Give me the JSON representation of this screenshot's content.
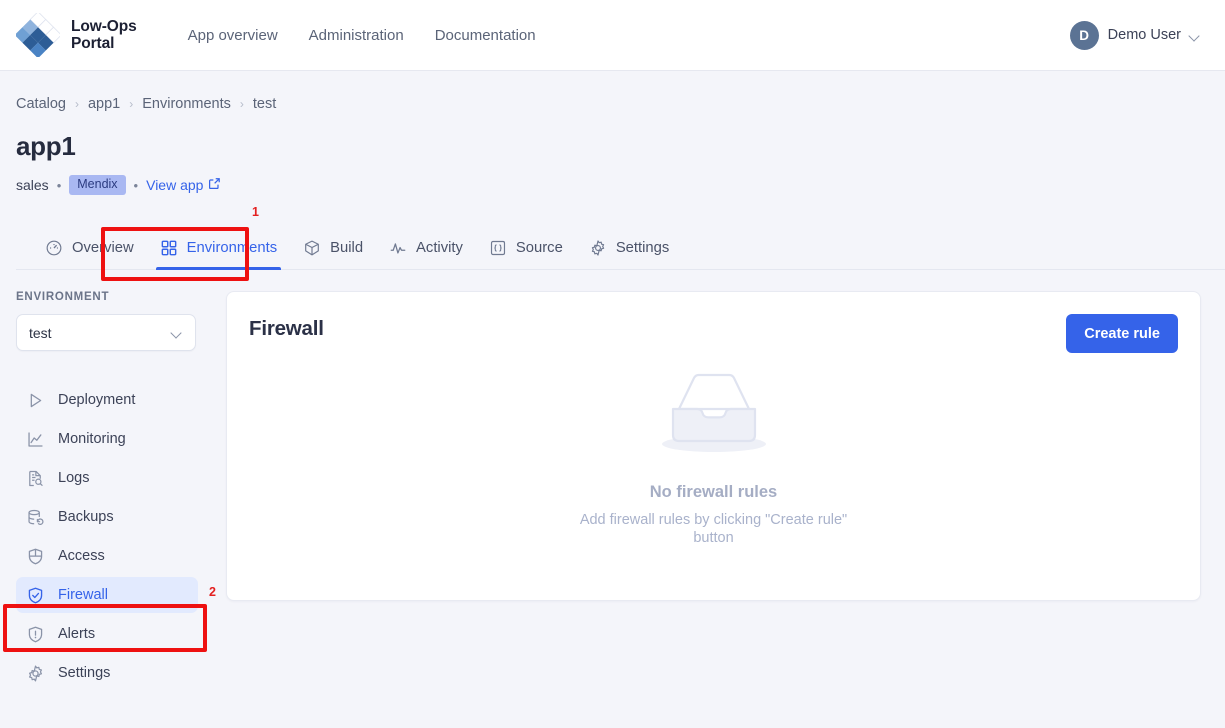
{
  "app": {
    "brand_line1": "Low-Ops",
    "brand_line2": "Portal",
    "logo_icon": "diamond-grid-logo"
  },
  "topnav": {
    "links": [
      {
        "label": "App overview"
      },
      {
        "label": "Administration"
      },
      {
        "label": "Documentation"
      }
    ],
    "user": {
      "initial": "D",
      "name": "Demo User",
      "caret_icon": "chevron-down-icon"
    }
  },
  "breadcrumb": {
    "separator": "›",
    "items": [
      {
        "label": "Catalog"
      },
      {
        "label": "app1"
      },
      {
        "label": "Environments"
      },
      {
        "label": "test"
      }
    ]
  },
  "header": {
    "title": "app1",
    "owner": "sales",
    "dot": "•",
    "badge": "Mendix",
    "view_app": "View app",
    "view_app_icon": "external-link-icon"
  },
  "tabs": [
    {
      "label": "Overview",
      "icon": "gauge-icon",
      "active": false
    },
    {
      "label": "Environments",
      "icon": "grid-icon",
      "active": true
    },
    {
      "label": "Build",
      "icon": "box-icon",
      "active": false
    },
    {
      "label": "Activity",
      "icon": "pulse-icon",
      "active": false
    },
    {
      "label": "Source",
      "icon": "code-braces-icon",
      "active": false
    },
    {
      "label": "Settings",
      "icon": "gear-icon",
      "active": false
    }
  ],
  "sidebar": {
    "section_label": "ENVIRONMENT",
    "env_select": {
      "value": "test",
      "caret_icon": "chevron-down-icon"
    },
    "items": [
      {
        "label": "Deployment",
        "icon": "play-triangle-icon",
        "active": false
      },
      {
        "label": "Monitoring",
        "icon": "line-chart-icon",
        "active": false
      },
      {
        "label": "Logs",
        "icon": "document-search-icon",
        "active": false
      },
      {
        "label": "Backups",
        "icon": "database-refresh-icon",
        "active": false
      },
      {
        "label": "Access",
        "icon": "shield-icon",
        "active": false
      },
      {
        "label": "Firewall",
        "icon": "shield-check-icon",
        "active": true
      },
      {
        "label": "Alerts",
        "icon": "shield-alert-icon",
        "active": false
      },
      {
        "label": "Settings",
        "icon": "gear-icon",
        "active": false
      }
    ]
  },
  "main": {
    "card_title": "Firewall",
    "create_button": "Create rule",
    "empty_state": {
      "illustration": "empty-inbox-tray-icon",
      "title": "No firewall rules",
      "subtitle": "Add firewall rules by clicking \"Create rule\" button"
    }
  },
  "annotations": [
    {
      "number": "1",
      "target": "tab-environments"
    },
    {
      "number": "2",
      "target": "sidebar-item-firewall"
    }
  ],
  "colors": {
    "accent": "#3563e9",
    "page_bg": "#f4f5fa",
    "annotation": "#ee1111",
    "badge_bg": "#a9b8f2",
    "active_item_bg": "#e2eafe"
  }
}
